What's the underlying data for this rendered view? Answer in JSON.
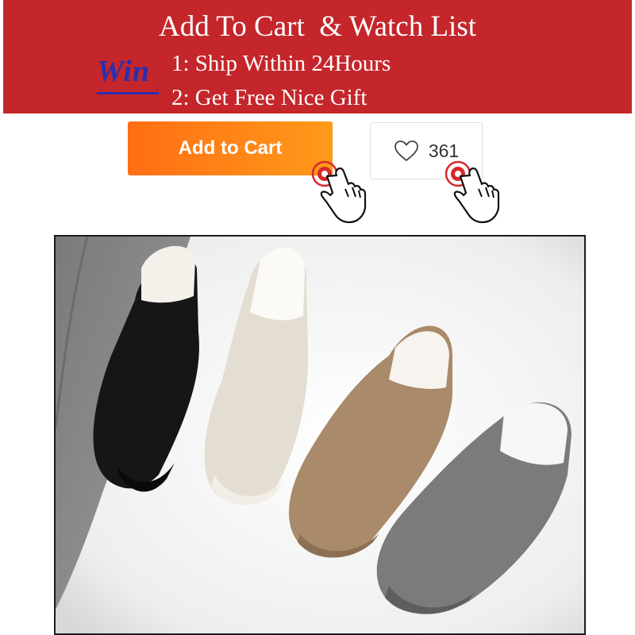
{
  "banner": {
    "title": "Add To Cart  & Watch List",
    "win_label": "Win",
    "perks": [
      "1: Ship Within 24Hours",
      "2: Get Free Nice Gift"
    ],
    "background_color": "#c4262b",
    "win_color": "#2a2fb0"
  },
  "actions": {
    "add_to_cart_label": "Add to Cart",
    "wishlist_count": "361",
    "add_to_cart_color": "#ff7f17"
  },
  "icons": {
    "heart": "heart-icon",
    "hand": "pointing-hand-cursor-icon"
  },
  "product_image": {
    "shoe_colors": [
      "#161616",
      "#e3ddd2",
      "#a98a6a",
      "#7b7b7b"
    ]
  }
}
